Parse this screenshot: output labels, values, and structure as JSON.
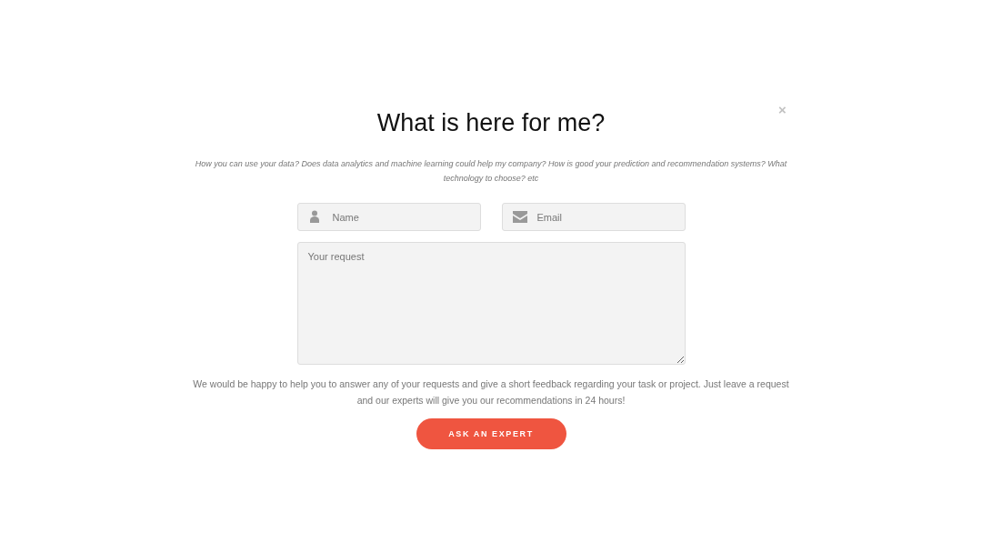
{
  "dialog": {
    "close": "×",
    "title": "What is here for me?",
    "subtitle": "How you can use your data? Does data analytics and machine learning could help my company? How is good your prediction and recommendation systems? What technology to choose? etc",
    "fields": [
      {
        "kind": "person",
        "placeholder": "Name"
      },
      {
        "kind": "email",
        "placeholder": "Email"
      }
    ],
    "request": {
      "placeholder": "Your request"
    },
    "note": "We would be happy to help you to answer any of your requests and give a short feedback regarding your task or project. Just leave a request and our experts will give you our recommendations in 24 hours!",
    "button": "ASK AN EXPERT"
  }
}
